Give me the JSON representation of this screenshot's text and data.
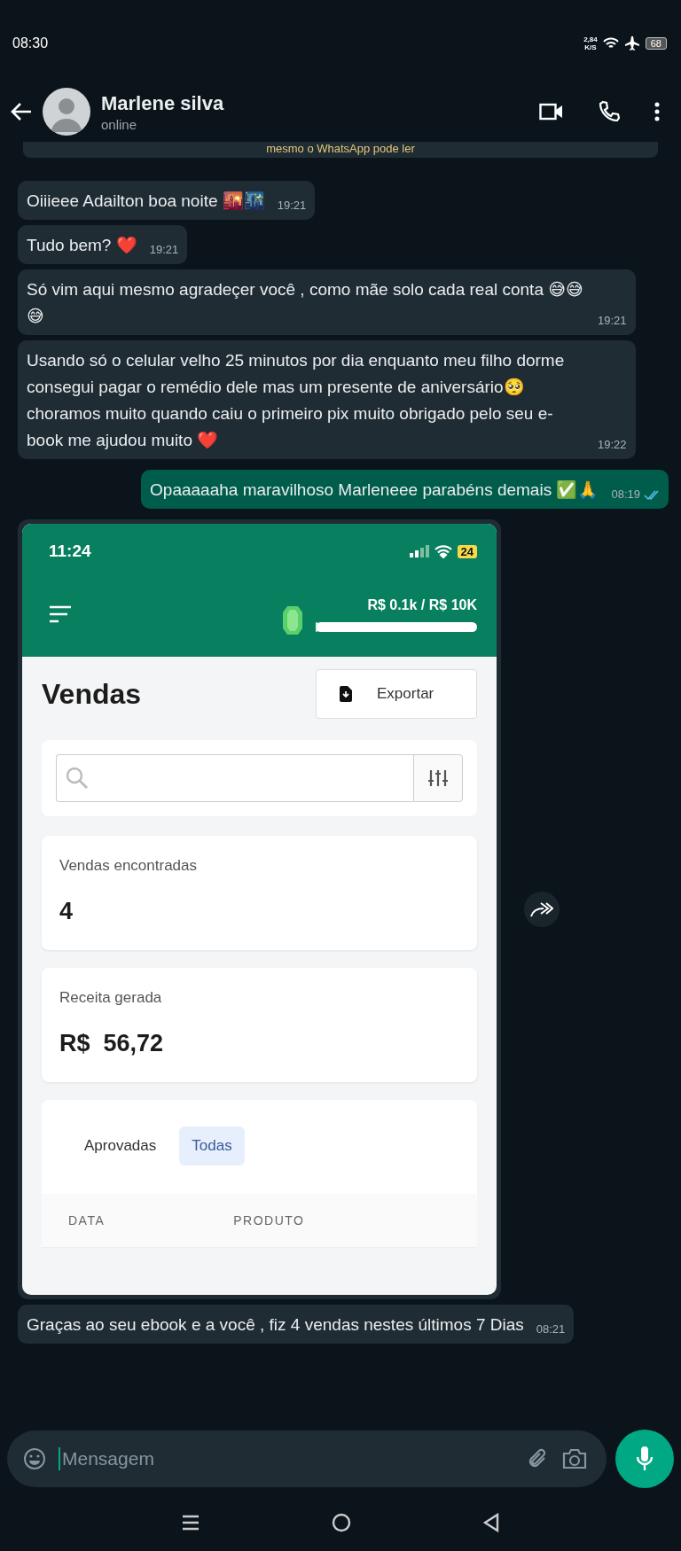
{
  "status_bar": {
    "time": "08:30",
    "speed_value": "2,84",
    "speed_unit": "K/S",
    "battery": "68"
  },
  "chat": {
    "contact_name": "Marlene silva",
    "presence": "online"
  },
  "notice": "mesmo o WhatsApp pode ler",
  "messages": [
    {
      "kind": "text",
      "sent": false,
      "text": "Oiiieee Adailton  boa noite 🌇🌃",
      "time": "19:21"
    },
    {
      "kind": "text",
      "sent": false,
      "text": "Tudo bem? ❤️",
      "time": "19:21"
    },
    {
      "kind": "text",
      "sent": false,
      "text": "Só vim aqui mesmo agradeçer você , como mãe solo cada real conta 😅😅😅",
      "time": "19:21"
    },
    {
      "kind": "text",
      "sent": false,
      "text": "Usando só o celular velho 25 minutos por dia enquanto meu filho dorme consegui pagar o remédio dele mas um presente de aniversário🥺 choramos muito quando caiu o primeiro pix muito obrigado pelo seu e-book me ajudou muito ❤️",
      "time": "19:22"
    },
    {
      "kind": "text",
      "sent": true,
      "text": "Opaaaaaha maravilhoso Marleneee parabéns demais ✅🙏",
      "time": "08:19",
      "read": true
    },
    {
      "kind": "image",
      "sent": false,
      "screenshot": {
        "time": "11:24",
        "battery": "24",
        "goal": {
          "text": "R$ 0.1k / R$ 10K",
          "level": 0.01
        },
        "title": "Vendas",
        "export_button": "Exportar",
        "stats": [
          {
            "label": "Vendas encontradas",
            "value": "4"
          },
          {
            "label": "Receita gerada",
            "value": "R$  56,72"
          }
        ],
        "tabs": [
          {
            "label": "Aprovadas",
            "selected": false
          },
          {
            "label": "Todas",
            "selected": true
          }
        ],
        "table": {
          "columns": [
            "DATA",
            "PRODUTO"
          ]
        }
      }
    },
    {
      "kind": "text",
      "sent": false,
      "text": "Graças ao seu ebook e a  você , fiz 4 vendas nestes últimos 7 Dias",
      "time": "08:21"
    }
  ],
  "composer": {
    "placeholder": "Mensagem"
  }
}
